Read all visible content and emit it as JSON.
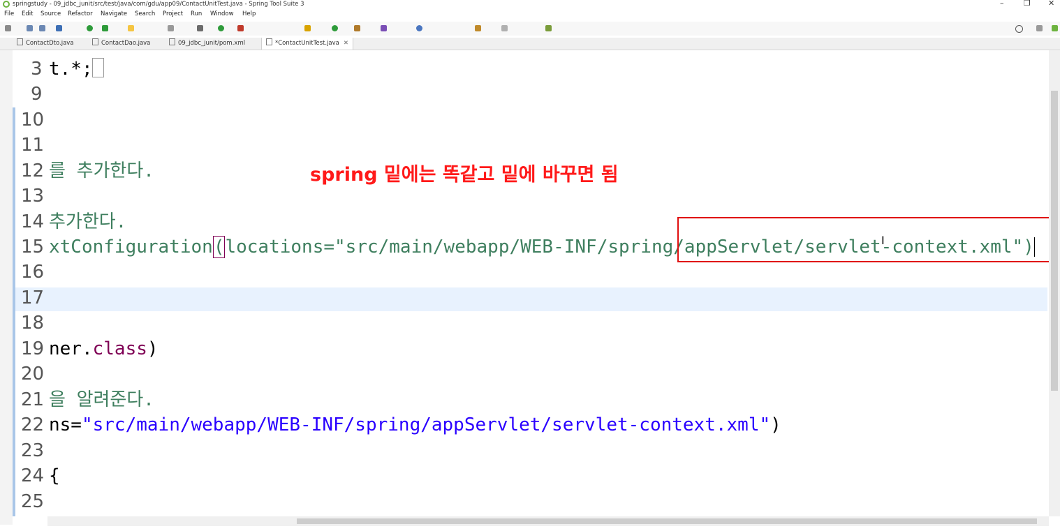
{
  "window": {
    "title": "springstudy - 09_jdbc_junit/src/test/java/com/gdu/app09/ContactUnitTest.java - Spring Tool Suite 3",
    "minimize": "–",
    "restore": "❐",
    "close": "✕"
  },
  "menubar": [
    "File",
    "Edit",
    "Source",
    "Refactor",
    "Navigate",
    "Search",
    "Project",
    "Run",
    "Window",
    "Help"
  ],
  "tabs": [
    {
      "label": "ContactDto.java",
      "active": false
    },
    {
      "label": "ContactDao.java",
      "active": false
    },
    {
      "label": "09_jdbc_junit/pom.xml",
      "active": false
    },
    {
      "label": "*ContactUnitTest.java",
      "active": true
    }
  ],
  "tab_close": "✕",
  "editor": {
    "lines": [
      {
        "num": "3",
        "text": "t.*;"
      },
      {
        "num": "9",
        "text": ""
      },
      {
        "num": "10",
        "text": ""
      },
      {
        "num": "11",
        "text": ""
      },
      {
        "num": "12",
        "text": "를 추가한다."
      },
      {
        "num": "13",
        "text": ""
      },
      {
        "num": "14",
        "text": " 추가한다."
      },
      {
        "num": "15",
        "text_a": "xtConfiguration",
        "text_b": "(",
        "text_c": "locations=",
        "text_d": "\"src/main/webapp/WEB-INF/spring/appServlet/servlet-context.xml\"",
        "text_e": ")"
      },
      {
        "num": "16",
        "text": ""
      },
      {
        "num": "17",
        "text": ""
      },
      {
        "num": "18",
        "text": ""
      },
      {
        "num": "19",
        "text_a": "ner.",
        "text_b": "class",
        "text_c": ")"
      },
      {
        "num": "20",
        "text": ""
      },
      {
        "num": "21",
        "text": "을 알려준다."
      },
      {
        "num": "22",
        "text_a": "ns=",
        "text_b": "\"src/main/webapp/WEB-INF/spring/appServlet/servlet-context.xml\"",
        "text_c": ")"
      },
      {
        "num": "23",
        "text": ""
      },
      {
        "num": "24",
        "text": "{"
      },
      {
        "num": "25",
        "text": ""
      }
    ]
  },
  "annotation": "spring 밑에는 똑같고 밑에 바꾸면 됨",
  "colors": {
    "comment": "#3f7f5f",
    "string": "#2a00ff",
    "keyword": "#7f0055",
    "annotation_red": "#ff1a1a",
    "current_line": "#e8f2fe"
  }
}
